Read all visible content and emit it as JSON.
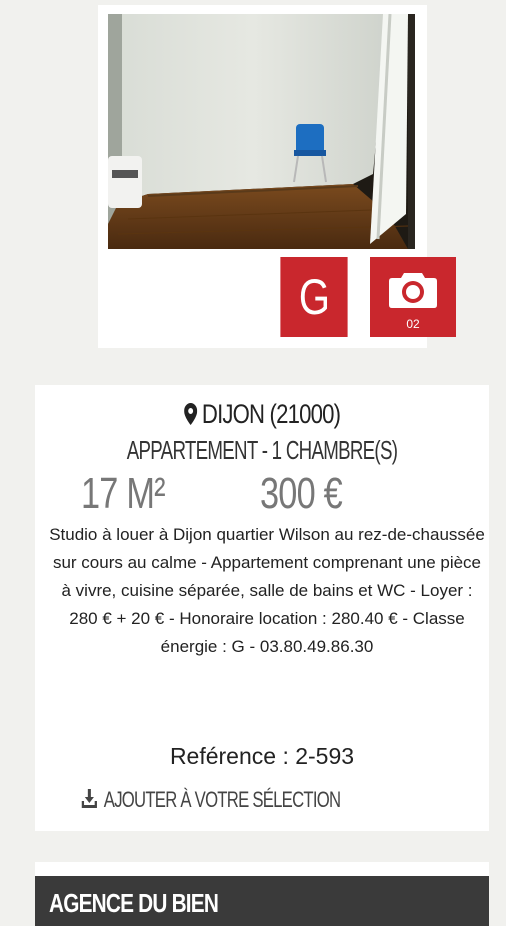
{
  "listing": {
    "photo_alt": "Room photo",
    "energy_class": "G",
    "photo_count": "02",
    "location": "DIJON (21000)",
    "type": "APPARTEMENT - 1 CHAMBRE(S)",
    "surface": "17 M²",
    "price": "300 €",
    "description": "Studio à louer à Dijon quartier Wilson au rez-de-chaussée sur cours au calme - Appartement comprenant une pièce à vivre, cuisine séparée, salle de bains et WC - Loyer : 280 € + 20 € - Honoraire location : 280.40 € - Classe énergie : G - 03.80.49.86.30",
    "reference": "Reférence : 2-593",
    "add_to_selection": "AJOUTER À VOTRE SÉLECTION"
  },
  "agency": {
    "title": "AGENCE DU BIEN"
  },
  "colors": {
    "accent_red": "#c9272d",
    "dark_bar": "#3a3a3a",
    "page_bg": "#f1f1ee"
  },
  "icons": {
    "location": "map-pin-icon",
    "camera": "camera-icon",
    "download": "download-icon"
  }
}
